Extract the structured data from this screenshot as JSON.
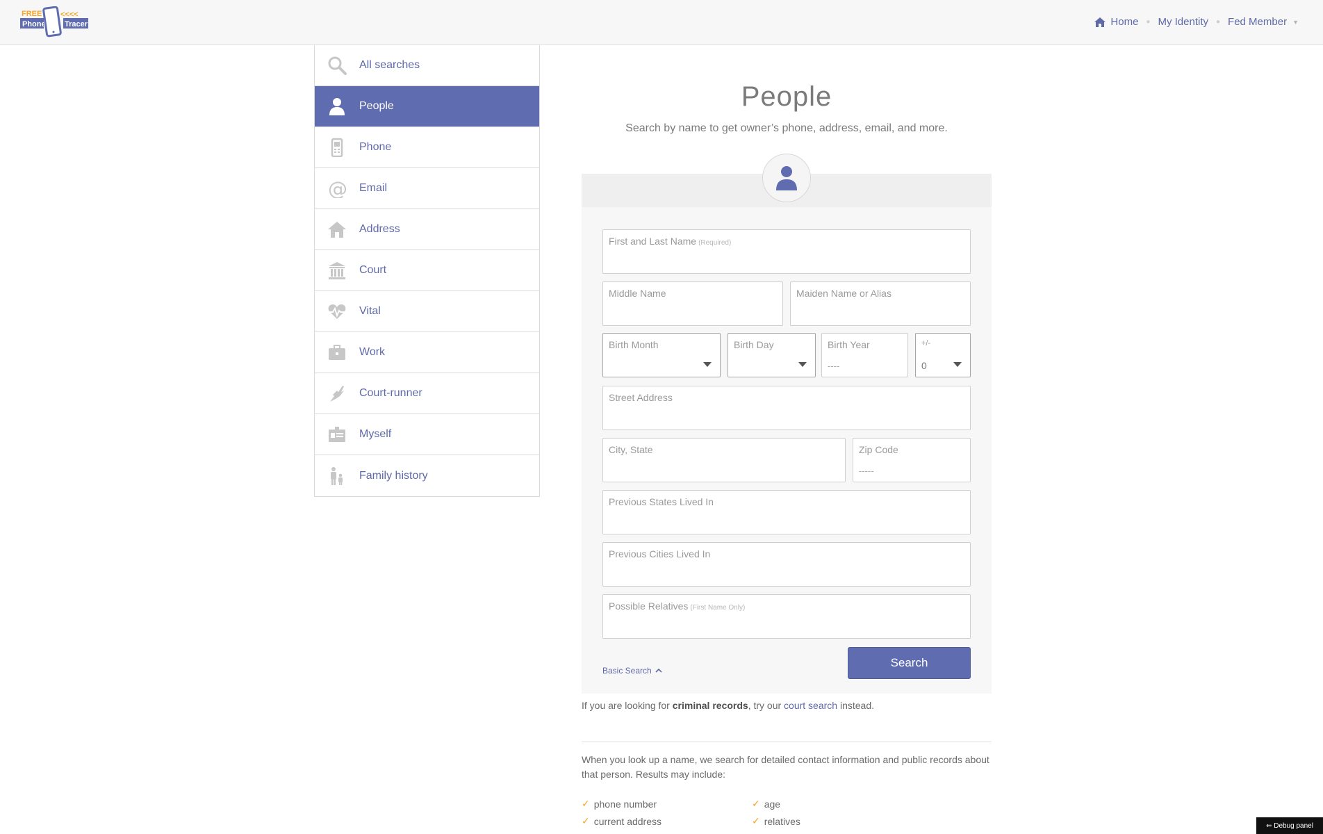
{
  "header": {
    "logo": {
      "line1": "FREE",
      "left": "Phone",
      "right": "Tracer"
    },
    "nav": {
      "home": "Home",
      "identity": "My Identity",
      "member": "Fed Member"
    }
  },
  "sidebar": {
    "items": [
      {
        "label": "All searches",
        "icon": "search-icon"
      },
      {
        "label": "People",
        "icon": "person-icon",
        "active": true
      },
      {
        "label": "Phone",
        "icon": "phone-icon"
      },
      {
        "label": "Email",
        "icon": "at-sign-icon"
      },
      {
        "label": "Address",
        "icon": "house-icon"
      },
      {
        "label": "Court",
        "icon": "courthouse-icon"
      },
      {
        "label": "Vital",
        "icon": "heartbeat-icon"
      },
      {
        "label": "Work",
        "icon": "briefcase-icon"
      },
      {
        "label": "Court-runner",
        "icon": "winged-foot-icon"
      },
      {
        "label": "Myself",
        "icon": "id-card-icon"
      },
      {
        "label": "Family history",
        "icon": "family-icon"
      }
    ]
  },
  "main": {
    "title": "People",
    "subtitle": "Search by name to get owner’s phone, address, email, and more.",
    "form": {
      "name_label": "First and Last Name",
      "name_required": "(Required)",
      "middle_label": "Middle Name",
      "maiden_label": "Maiden Name or Alias",
      "birth_month_label": "Birth Month",
      "birth_day_label": "Birth Day",
      "birth_year_label": "Birth Year",
      "birth_year_placeholder": "----",
      "range_label": "+/-",
      "range_value": "0",
      "street_label": "Street Address",
      "city_label": "City, State",
      "zip_label": "Zip Code",
      "zip_placeholder": "-----",
      "prev_states_label": "Previous States Lived In",
      "prev_cities_label": "Previous Cities Lived In",
      "relatives_label": "Possible Relatives",
      "relatives_note": "(First Name Only)",
      "basic_search": "Basic Search",
      "search_button": "Search"
    },
    "criminal_prefix": "If you are looking for ",
    "criminal_bold": "criminal records",
    "criminal_mid": ", try our ",
    "criminal_link": "court search",
    "criminal_suffix": " instead.",
    "info_text": "When you look up a name, we search for detailed contact information and public records about that person. Results may include:",
    "results": [
      "phone number",
      "age",
      "current address",
      "relatives"
    ]
  },
  "debug": "⇐ Debug panel",
  "colors": {
    "accent": "#5f6db0",
    "link": "#5f69a9",
    "check": "#f5a623",
    "logo_orange": "#f5a623"
  }
}
